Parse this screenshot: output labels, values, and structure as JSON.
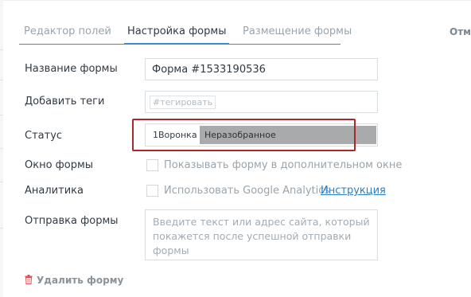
{
  "tabs": [
    {
      "label": "Редактор полей",
      "active": false
    },
    {
      "label": "Настройка формы",
      "active": true
    },
    {
      "label": "Размещение формы",
      "active": false
    }
  ],
  "header": {
    "cancel_label": "Отме"
  },
  "form": {
    "name_label": "Название формы",
    "name_value": "Форма #1533190536",
    "tags_label": "Добавить теги",
    "tags_placeholder": "#тегировать",
    "status_label": "Статус",
    "status_pipeline": "1Воронка",
    "status_stage": "Неразобранное",
    "status_stage_color": "#a8aaac",
    "highlight_color": "#a52a2a",
    "window_label": "Окно формы",
    "window_checkbox_label": "Показывать форму в дополнительном окне",
    "window_checked": false,
    "analytics_label": "Аналитика",
    "analytics_checkbox_label": "Использовать Google Analytics",
    "analytics_checked": false,
    "analytics_link": "Инструкция",
    "submit_label": "Отправка формы",
    "submit_placeholder": "Введите текст или адрес сайта, который покажется после успешной отправки формы",
    "delete_label": "Удалить форму",
    "delete_icon": "trash-icon",
    "accent_color": "#3a8bd0",
    "link_color": "#2c7fc5"
  }
}
